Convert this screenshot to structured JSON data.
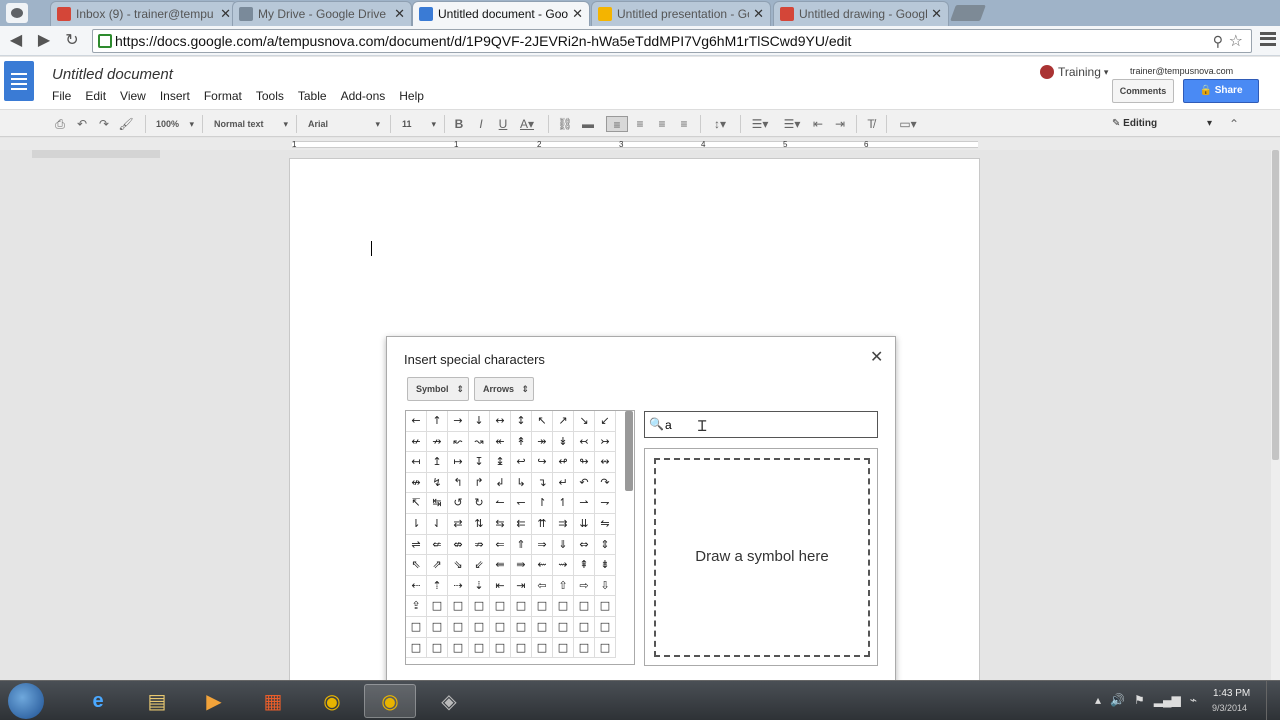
{
  "browser": {
    "tabs": [
      {
        "label": "Inbox (9) - trainer@tempu",
        "color": "#d44638"
      },
      {
        "label": "My Drive - Google Drive",
        "color": "#7a8a9a"
      },
      {
        "label": "Untitled document - Goog",
        "color": "#3a7bd5"
      },
      {
        "label": "Untitled presentation - Go",
        "color": "#f4b400"
      },
      {
        "label": "Untitled drawing - Google",
        "color": "#d44638"
      }
    ],
    "url": "https://docs.google.com/a/tempusnova.com/document/d/1P9QVF-2JEVRi2n-hWa5eTddMPI7Vg6hM1rTlSCwd9YU/edit"
  },
  "docs": {
    "title": "Untitled document",
    "menu": [
      "File",
      "Edit",
      "View",
      "Insert",
      "Format",
      "Tools",
      "Table",
      "Add-ons",
      "Help"
    ],
    "account": "Training",
    "email": "trainer@tempusnova.com",
    "comments_label": "Comments",
    "share_label": "Share",
    "toolbar": {
      "zoom": "100%",
      "style": "Normal text",
      "font": "Arial",
      "size": "11",
      "mode": "Editing"
    },
    "ruler_numbers": [
      "1",
      "1",
      "2",
      "3",
      "4",
      "5",
      "6"
    ]
  },
  "dialog": {
    "title": "Insert special characters",
    "category": "Symbol",
    "subcategory": "Arrows",
    "search_value": "a",
    "draw_hint": "Draw a symbol here",
    "symbols": [
      [
        "←",
        "↑",
        "→",
        "↓",
        "↔",
        "↕",
        "↖",
        "↗",
        "↘",
        "↙"
      ],
      [
        "↚",
        "↛",
        "↜",
        "↝",
        "↞",
        "↟",
        "↠",
        "↡",
        "↢",
        "↣"
      ],
      [
        "↤",
        "↥",
        "↦",
        "↧",
        "↨",
        "↩",
        "↪",
        "↫",
        "↬",
        "↭"
      ],
      [
        "↮",
        "↯",
        "↰",
        "↱",
        "↲",
        "↳",
        "↴",
        "↵",
        "↶",
        "↷"
      ],
      [
        "↸",
        "↹",
        "↺",
        "↻",
        "↼",
        "↽",
        "↾",
        "↿",
        "⇀",
        "⇁"
      ],
      [
        "⇂",
        "⇃",
        "⇄",
        "⇅",
        "⇆",
        "⇇",
        "⇈",
        "⇉",
        "⇊",
        "⇋"
      ],
      [
        "⇌",
        "⇍",
        "⇎",
        "⇏",
        "⇐",
        "⇑",
        "⇒",
        "⇓",
        "⇔",
        "⇕"
      ],
      [
        "⇖",
        "⇗",
        "⇘",
        "⇙",
        "⇚",
        "⇛",
        "⇜",
        "⇝",
        "⇞",
        "⇟"
      ],
      [
        "⇠",
        "⇡",
        "⇢",
        "⇣",
        "⇤",
        "⇥",
        "⇦",
        "⇧",
        "⇨",
        "⇩"
      ],
      [
        "⇪",
        "□",
        "□",
        "□",
        "□",
        "□",
        "□",
        "□",
        "□",
        "□"
      ],
      [
        "□",
        "□",
        "□",
        "□",
        "□",
        "□",
        "□",
        "□",
        "□",
        "□"
      ],
      [
        "□",
        "□",
        "□",
        "□",
        "□",
        "□",
        "□",
        "□",
        "□",
        "□"
      ]
    ]
  },
  "taskbar": {
    "apps": [
      {
        "name": "internet-explorer",
        "glyph": "e"
      },
      {
        "name": "file-explorer",
        "glyph": "▤"
      },
      {
        "name": "media-player",
        "glyph": "▶"
      },
      {
        "name": "office",
        "glyph": "▦"
      },
      {
        "name": "chrome",
        "glyph": "◉"
      },
      {
        "name": "chrome-active",
        "glyph": "◉"
      },
      {
        "name": "screen-recorder",
        "glyph": "◈"
      }
    ],
    "time": "1:43 PM",
    "date": "9/3/2014"
  }
}
